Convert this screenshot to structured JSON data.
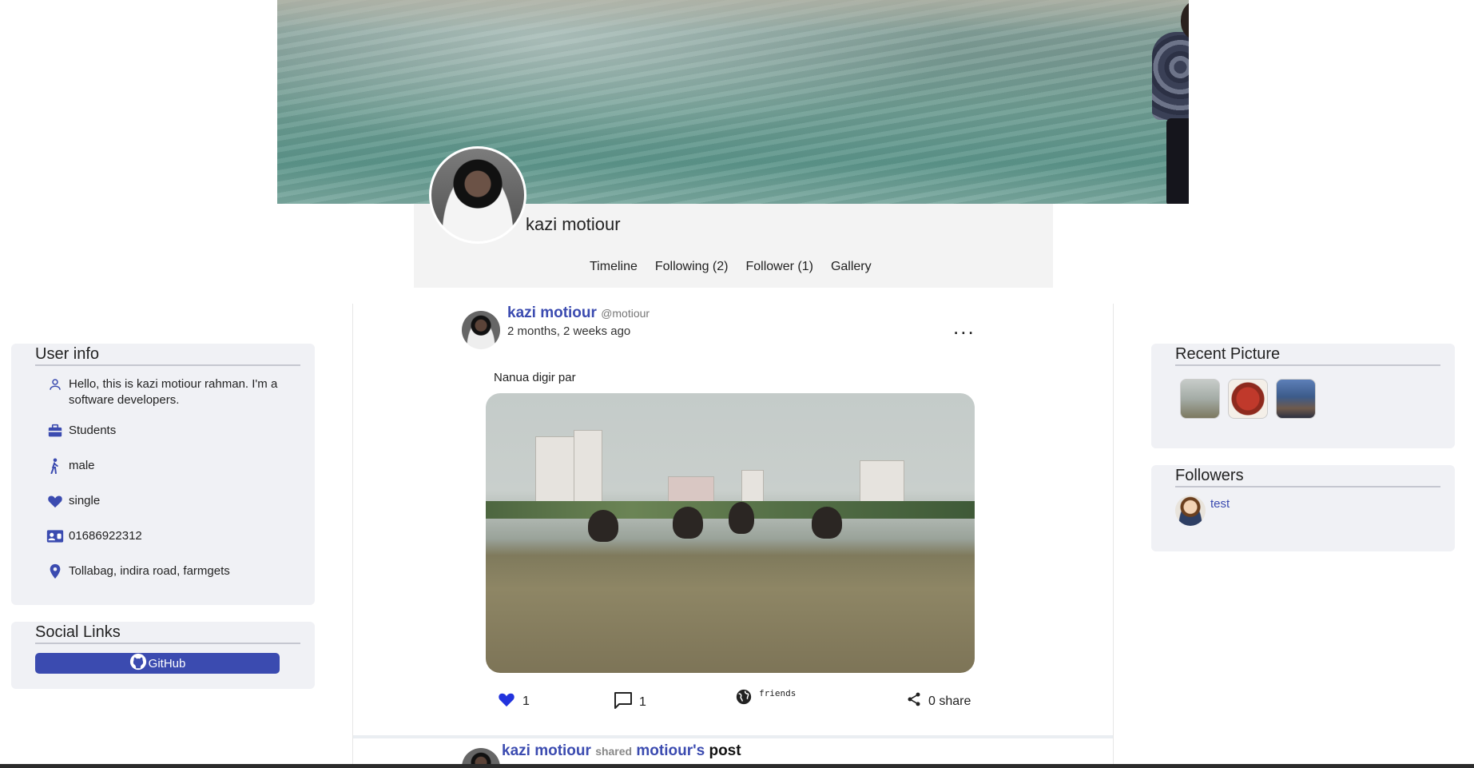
{
  "profile": {
    "name": "kazi motiour",
    "tabs": [
      "Timeline",
      "Following (2)",
      "Follower (1)",
      "Gallery"
    ]
  },
  "user_info": {
    "title": "User info",
    "bio": "Hello, this is kazi motiour rahman. I'm a software developers.",
    "occupation": "Students",
    "gender": "male",
    "relationship": "single",
    "phone": "01686922312",
    "address": "Tollabag, indira road, farmgets"
  },
  "social_links": {
    "title": "Social Links",
    "github_label": "GitHub"
  },
  "post": {
    "author": "kazi motiour",
    "handle": "@motiour",
    "time": "2 months, 2 weeks ago",
    "more": "...",
    "text": "Nanua digir par",
    "likes": "1",
    "comments": "1",
    "visibility": "friends",
    "share": "0 share"
  },
  "shared_post": {
    "author": "kazi motiour",
    "verb": "shared",
    "original_owner": "motiour's",
    "post_word": "post"
  },
  "recent_picture": {
    "title": "Recent Picture"
  },
  "followers": {
    "title": "Followers",
    "items": [
      {
        "name": "test"
      }
    ]
  },
  "colors": {
    "accent": "#3b4bb0",
    "card_bg": "#f0f1f5",
    "like": "#2233dd"
  }
}
